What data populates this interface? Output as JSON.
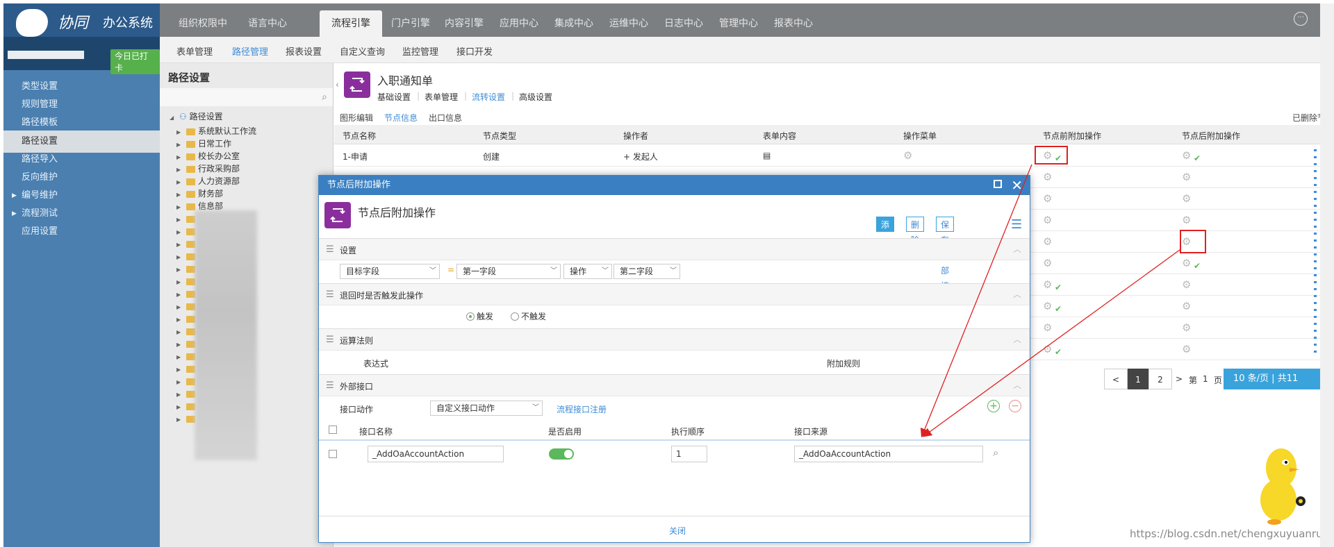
{
  "app": {
    "logo_text": "协同",
    "logo_sub": "办公系统",
    "checkin": "今日已打卡"
  },
  "topnav": {
    "tabs": [
      "组织权限中心",
      "语言中心",
      "流程引擎",
      "门户引擎",
      "内容引擎",
      "应用中心",
      "集成中心",
      "运维中心",
      "日志中心",
      "管理中心",
      "报表中心"
    ],
    "active": "流程引擎"
  },
  "subnav": {
    "tabs": [
      "表单管理",
      "路径管理",
      "报表设置",
      "自定义查询",
      "监控管理",
      "接口开发"
    ],
    "active": "路径管理"
  },
  "sidebar": {
    "items": [
      {
        "label": "类型设置"
      },
      {
        "label": "规则管理"
      },
      {
        "label": "路径模板"
      },
      {
        "label": "路径设置"
      },
      {
        "label": "路径导入"
      },
      {
        "label": "反向维护"
      },
      {
        "label": "编号维护"
      },
      {
        "label": "流程测试"
      },
      {
        "label": "应用设置"
      }
    ],
    "active": "路径设置"
  },
  "tree": {
    "title": "路径设置",
    "root": "路径设置",
    "nodes": [
      "系统默认工作流",
      "日常工作",
      "校长办公室",
      "行政采购部",
      "人力资源部",
      "财务部",
      "信息部"
    ]
  },
  "main": {
    "title": "入职通知单",
    "tabs": [
      "基础设置",
      "表单管理",
      "流转设置",
      "高级设置"
    ],
    "active_tab": "流转设置",
    "subtabs": [
      "图形编辑",
      "节点信息",
      "出口信息"
    ],
    "active_subtab": "节点信息",
    "deleted_nodes": "已删除节点",
    "columns": [
      "节点名称",
      "节点类型",
      "操作者",
      "表单内容",
      "操作菜单",
      "节点前附加操作",
      "节点后附加操作"
    ],
    "first_row": {
      "name": "1-申请",
      "type": "创建",
      "operator": "发起人"
    }
  },
  "pager": {
    "prev": "<",
    "pages": [
      "1",
      "2"
    ],
    "next": ">",
    "page_label": "第",
    "page_num": "1",
    "page_unit": "页",
    "size_text": "10  条/页 | 共11"
  },
  "modal": {
    "title": "节点后附加操作",
    "heading": "节点后附加操作",
    "buttons": {
      "add": "添加",
      "delete": "删除",
      "save": "保存外部接口"
    },
    "sections": {
      "settings": "设置",
      "trigger": "退回时是否触发此操作",
      "rules": "运算法则",
      "external": "外部接口"
    },
    "settings_row": {
      "target": "目标字段",
      "equals": "=",
      "field1": "第一字段",
      "op": "操作",
      "field2": "第二字段"
    },
    "trigger_opts": {
      "yes": "触发",
      "no": "不触发"
    },
    "rules_cols": {
      "expr": "表达式",
      "extra": "附加规则"
    },
    "api_action": {
      "label": "接口动作",
      "value": "自定义接口动作",
      "register_link": "流程接口注册"
    },
    "api_table": {
      "columns": [
        "接口名称",
        "是否启用",
        "执行顺序",
        "接口来源"
      ],
      "row": {
        "name": "_AddOaAccountAction",
        "order": "1",
        "source": "_AddOaAccountAction"
      }
    },
    "close": "关闭"
  },
  "watermark": "https://blog.csdn.net/chengxuyuanruhuo"
}
